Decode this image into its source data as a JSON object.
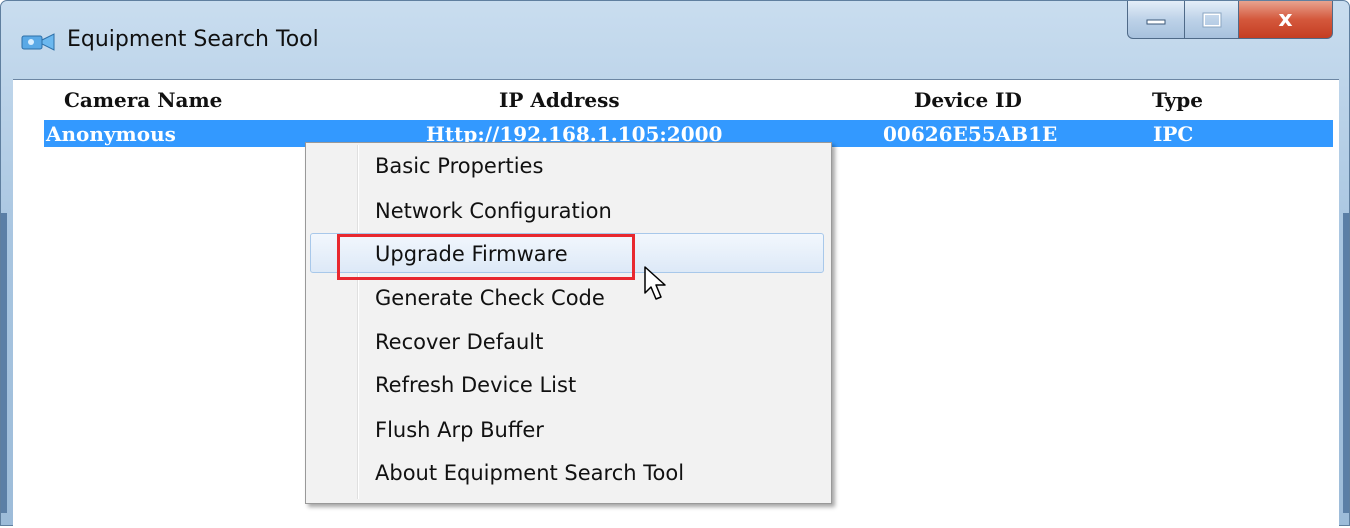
{
  "window": {
    "title": "Equipment Search Tool",
    "app_icon": "camera-icon",
    "caption_buttons": {
      "minimize_icon": "minimize-icon",
      "maximize_icon": "maximize-icon",
      "close_glyph": "x"
    }
  },
  "table": {
    "headers": {
      "camera_name": "Camera Name",
      "ip_address": "IP Address",
      "device_id": "Device ID",
      "type": "Type"
    },
    "rows": [
      {
        "camera_name": "Anonymous",
        "ip_address": "Http://192.168.1.105:2000",
        "device_id": "00626E55AB1E",
        "type": "IPC",
        "selected": true
      }
    ]
  },
  "context_menu": {
    "items": [
      {
        "label": "Basic Properties"
      },
      {
        "label": "Network Configuration"
      },
      {
        "label": "Upgrade Firmware",
        "hovered": true,
        "highlighted": true
      },
      {
        "label": "Generate Check Code"
      },
      {
        "label": "Recover Default"
      },
      {
        "label": "Refresh Device List"
      },
      {
        "label": "Flush Arp Buffer"
      },
      {
        "label": "About Equipment Search Tool"
      }
    ]
  },
  "colors": {
    "selection": "#3399ff",
    "highlight_border": "#e8282f",
    "close_button": "#c43d22"
  },
  "cursor_icon": "arrow-cursor-icon"
}
